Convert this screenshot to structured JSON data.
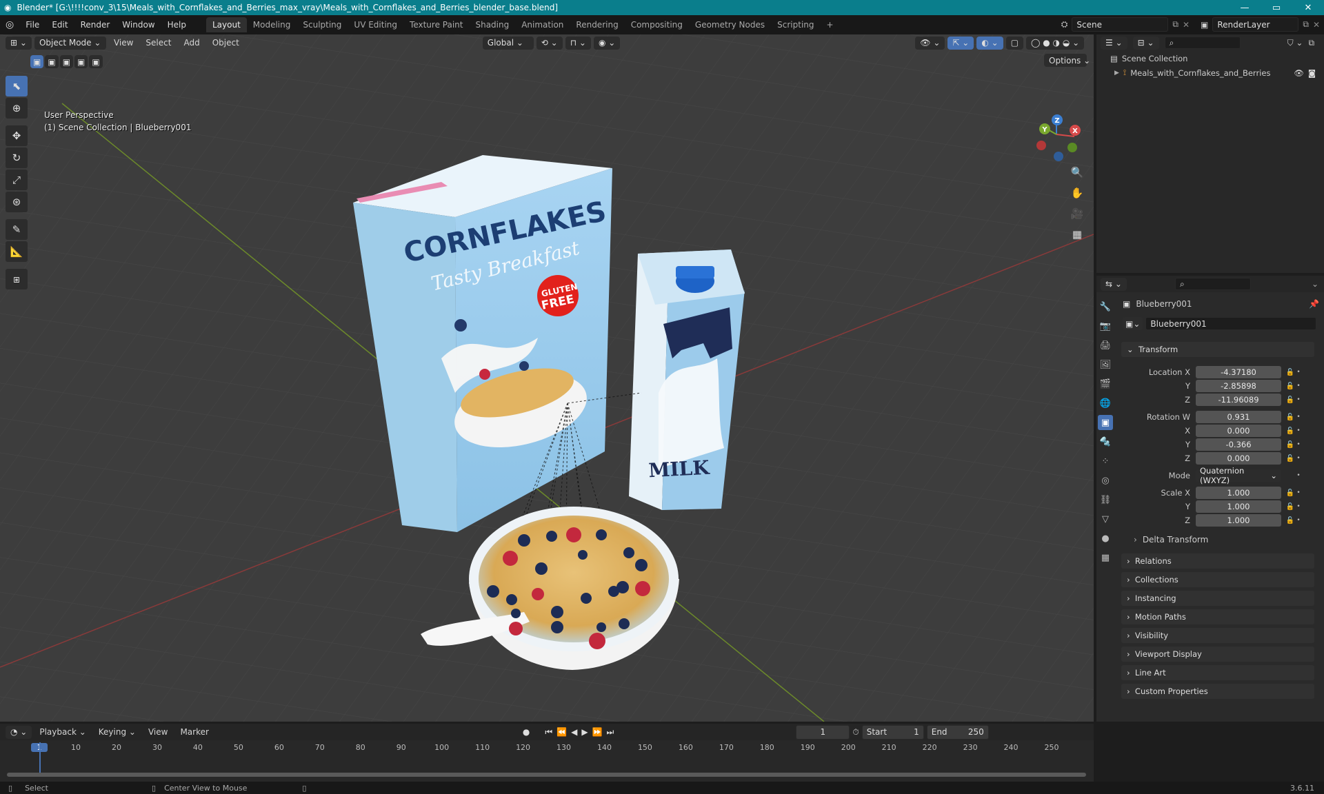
{
  "window": {
    "title": "Blender* [G:\\!!!!conv_3\\15\\Meals_with_Cornflakes_and_Berries_max_vray\\Meals_with_Cornflakes_and_Berries_blender_base.blend]",
    "minimize": "—",
    "maximize": "▭",
    "close": "✕"
  },
  "menu": [
    "File",
    "Edit",
    "Render",
    "Window",
    "Help"
  ],
  "workspaces": [
    "Layout",
    "Modeling",
    "Sculpting",
    "UV Editing",
    "Texture Paint",
    "Shading",
    "Animation",
    "Rendering",
    "Compositing",
    "Geometry Nodes",
    "Scripting"
  ],
  "scene": {
    "label": "Scene",
    "render_layer": "RenderLayer"
  },
  "viewport": {
    "mode": "Object Mode",
    "menus": [
      "View",
      "Select",
      "Add",
      "Object"
    ],
    "orientation": "Global",
    "options": "Options",
    "perspective": "User Perspective",
    "context": "(1) Scene Collection | Blueberry001"
  },
  "scene_objects": {
    "cereal_brand": "CORNFLAKES",
    "cereal_tagline": "Tasty Breakfast",
    "badge_top": "GLUTEN",
    "badge_bottom": "FREE",
    "milk_label": "MILK"
  },
  "outliner": {
    "root": "Scene Collection",
    "item": "Meals_with_Cornflakes_and_Berries"
  },
  "properties": {
    "object_name": "Blueberry001",
    "data_name": "Blueberry001",
    "transform_header": "Transform",
    "location_label": "Location X",
    "location": {
      "x": "-4.37180",
      "y": "-2.85898",
      "z": "-11.96089"
    },
    "rotation_label": "Rotation W",
    "rotation": {
      "w": "0.931",
      "x": "0.000",
      "y": "-0.366",
      "z": "0.000"
    },
    "mode_label": "Mode",
    "mode_value": "Quaternion (WXYZ)",
    "scale_label": "Scale X",
    "scale": {
      "x": "1.000",
      "y": "1.000",
      "z": "1.000"
    },
    "axis_y": "Y",
    "axis_z": "Z",
    "axis_x": "X",
    "delta": "Delta Transform",
    "panels": [
      "Relations",
      "Collections",
      "Instancing",
      "Motion Paths",
      "Visibility",
      "Viewport Display",
      "Line Art",
      "Custom Properties"
    ]
  },
  "timeline": {
    "menus": [
      "Playback",
      "Keying",
      "View",
      "Marker"
    ],
    "current_frame": "1",
    "start_label": "Start",
    "start": "1",
    "end_label": "End",
    "end": "250",
    "ticks": [
      "1",
      "10",
      "20",
      "30",
      "40",
      "50",
      "60",
      "70",
      "80",
      "90",
      "100",
      "110",
      "120",
      "130",
      "140",
      "150",
      "160",
      "170",
      "180",
      "190",
      "200",
      "210",
      "220",
      "230",
      "240",
      "250"
    ]
  },
  "status": {
    "select": "Select",
    "center": "Center View to Mouse",
    "version": "3.6.11"
  },
  "gizmo": {
    "x": "X",
    "y": "Y",
    "z": "Z"
  }
}
